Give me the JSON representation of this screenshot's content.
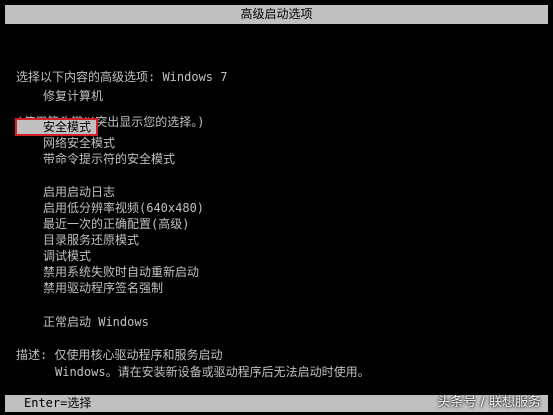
{
  "title": "高级启动选项",
  "intro": {
    "line1": "选择以下内容的高级选项: Windows 7",
    "line2": "(使用箭头键以突出显示您的选择。)"
  },
  "menu": {
    "repair": "修复计算机",
    "items": [
      "安全模式",
      "网络安全模式",
      "带命令提示符的安全模式",
      "启用启动日志",
      "启用低分辨率视频(640x480)",
      "最近一次的正确配置(高级)",
      "目录服务还原模式",
      "调试模式",
      "禁用系统失败时自动重新启动",
      "禁用驱动程序签名强制",
      "正常启动 Windows"
    ],
    "selected_index": 0
  },
  "description": {
    "line1": "描述: 仅使用核心驱动程序和服务启动",
    "line2": "Windows。请在安装新设备或驱动程序后无法启动时使用。"
  },
  "footer": {
    "hint": "Enter=选择"
  },
  "watermark": "头条号 / 联想服务",
  "colors": {
    "background": "#000000",
    "text": "#c0c0c0",
    "bar": "#c0c0c0",
    "selection_outline": "#d0212b"
  }
}
